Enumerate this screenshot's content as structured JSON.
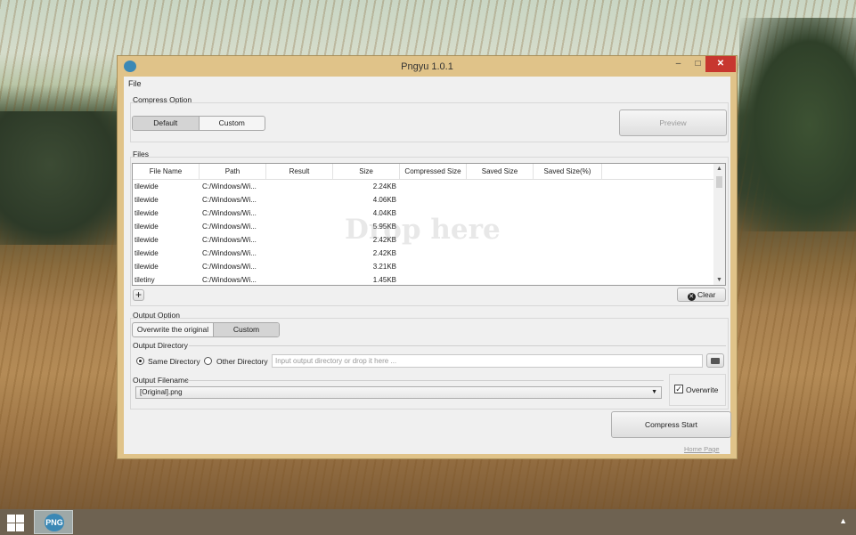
{
  "window": {
    "title": "Pngyu 1.0.1",
    "controls": {
      "minimize": "–",
      "maximize": "□",
      "close": "✕"
    }
  },
  "menu": {
    "file": "File"
  },
  "compress_option": {
    "label": "Compress Option",
    "options": [
      "Default",
      "Custom"
    ],
    "selected": "Default",
    "preview_label": "Preview"
  },
  "files": {
    "label": "Files",
    "columns": [
      "File Name",
      "Path",
      "Result",
      "Size",
      "Compressed Size",
      "Saved Size",
      "Saved Size(%)"
    ],
    "rows": [
      {
        "name": "tilewide",
        "path": "C:/Windows/Wi...",
        "result": "",
        "size": "2.24KB"
      },
      {
        "name": "tilewide",
        "path": "C:/Windows/Wi...",
        "result": "",
        "size": "4.06KB"
      },
      {
        "name": "tilewide",
        "path": "C:/Windows/Wi...",
        "result": "",
        "size": "4.04KB"
      },
      {
        "name": "tilewide",
        "path": "C:/Windows/Wi...",
        "result": "",
        "size": "5.95KB"
      },
      {
        "name": "tilewide",
        "path": "C:/Windows/Wi...",
        "result": "",
        "size": "2.42KB"
      },
      {
        "name": "tilewide",
        "path": "C:/Windows/Wi...",
        "result": "",
        "size": "2.42KB"
      },
      {
        "name": "tilewide",
        "path": "C:/Windows/Wi...",
        "result": "",
        "size": "3.21KB"
      },
      {
        "name": "tiletiny",
        "path": "C:/Windows/Wi...",
        "result": "",
        "size": "1.45KB"
      }
    ],
    "drop_hint": "Drop here",
    "add_label": "+",
    "clear_label": "Clear"
  },
  "output_option": {
    "label": "Output Option",
    "options": [
      "Overwrite the original",
      "Custom"
    ],
    "selected": "Custom",
    "directory": {
      "label": "Output Directory",
      "same_label": "Same Directory",
      "other_label": "Other Directory",
      "selected": "Same Directory",
      "placeholder": "Input output directory or drop it here ..."
    },
    "filename": {
      "label": "Output Filename",
      "value": "[Original].png",
      "overwrite_label": "Overwrite",
      "overwrite_checked": true
    }
  },
  "compress_start_label": "Compress Start",
  "home_page_label": "Home Page",
  "taskbar": {
    "app_logo_text": "PNG"
  }
}
